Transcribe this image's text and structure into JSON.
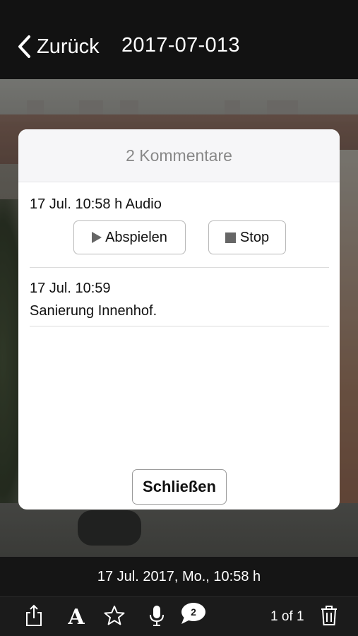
{
  "navbar": {
    "back_label": "Zurück",
    "title": "2017-07-013"
  },
  "modal": {
    "title": "2 Kommentare",
    "comments": [
      {
        "meta": "17 Jul. 10:58 h Audio",
        "play_label": "Abspielen",
        "stop_label": "Stop"
      },
      {
        "meta": "17 Jul. 10:59",
        "text": "Sanierung Innenhof."
      }
    ],
    "close_label": "Schließen"
  },
  "datebar": {
    "text": "17 Jul. 2017, Mo., 10:58 h"
  },
  "toolbar": {
    "font_glyph": "A",
    "comments_count": "2",
    "page_indicator": "1 of 1",
    "icons": [
      "share-icon",
      "font-icon",
      "star-icon",
      "microphone-icon",
      "comments-icon",
      "trash-icon"
    ]
  },
  "colors": {
    "bar_background": "#121212",
    "modal_background": "#ffffff",
    "header_background": "#f6f6f8",
    "title_gray": "#888888"
  }
}
